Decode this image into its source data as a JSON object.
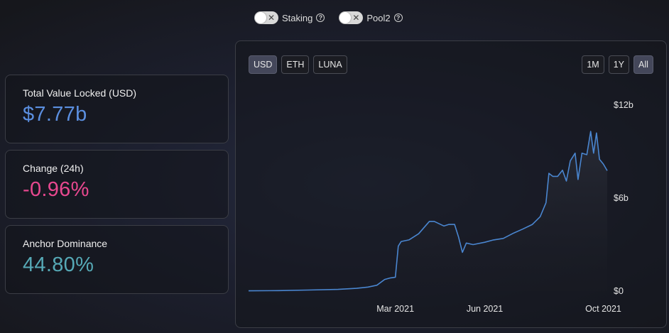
{
  "toggles": [
    {
      "label": "Staking",
      "on": false
    },
    {
      "label": "Pool2",
      "on": false
    }
  ],
  "stats": {
    "tvl": {
      "label": "Total Value Locked (USD)",
      "value": "$7.77b",
      "color": "#5b8fe0"
    },
    "change": {
      "label": "Change (24h)",
      "value": "-0.96%",
      "color": "#e8488f"
    },
    "dominance": {
      "label": "Anchor Dominance",
      "value": "44.80%",
      "color": "#56a9b6"
    }
  },
  "currency_buttons": [
    {
      "label": "USD",
      "active": true
    },
    {
      "label": "ETH",
      "active": false
    },
    {
      "label": "LUNA",
      "active": false
    }
  ],
  "range_buttons": [
    {
      "label": "1M",
      "active": false
    },
    {
      "label": "1Y",
      "active": false
    },
    {
      "label": "All",
      "active": true
    }
  ],
  "chart_data": {
    "type": "area",
    "line_color": "#4a86d0",
    "ylim": [
      0,
      12
    ],
    "y_ticks": [
      {
        "value": 12,
        "label": "$12b"
      },
      {
        "value": 6,
        "label": "$6b"
      },
      {
        "value": 0,
        "label": "$0"
      }
    ],
    "x_ticks": [
      {
        "value": "2021-03-01",
        "label": "Mar 2021"
      },
      {
        "value": "2021-06-01",
        "label": "Jun 2021"
      },
      {
        "value": "2021-10-01",
        "label": "Oct 2021"
      }
    ],
    "xlim": [
      "2020-10-01",
      "2021-10-05"
    ],
    "grid": false,
    "series": [
      {
        "values": [
          [
            "2020-10-01",
            0.02
          ],
          [
            "2020-11-01",
            0.03
          ],
          [
            "2020-12-01",
            0.07
          ],
          [
            "2021-01-01",
            0.11
          ],
          [
            "2021-01-20",
            0.18
          ],
          [
            "2021-02-01",
            0.26
          ],
          [
            "2021-02-10",
            0.38
          ],
          [
            "2021-02-18",
            0.75
          ],
          [
            "2021-02-24",
            0.85
          ],
          [
            "2021-03-01",
            0.9
          ],
          [
            "2021-03-04",
            2.9
          ],
          [
            "2021-03-07",
            3.2
          ],
          [
            "2021-03-15",
            3.3
          ],
          [
            "2021-03-25",
            3.7
          ],
          [
            "2021-04-05",
            4.5
          ],
          [
            "2021-04-10",
            4.5
          ],
          [
            "2021-04-20",
            4.2
          ],
          [
            "2021-04-25",
            4.3
          ],
          [
            "2021-05-01",
            4.3
          ],
          [
            "2021-05-05",
            3.5
          ],
          [
            "2021-05-09",
            2.5
          ],
          [
            "2021-05-13",
            3.1
          ],
          [
            "2021-05-20",
            3.0
          ],
          [
            "2021-06-01",
            3.15
          ],
          [
            "2021-06-10",
            3.3
          ],
          [
            "2021-06-20",
            3.4
          ],
          [
            "2021-07-01",
            3.75
          ],
          [
            "2021-07-10",
            4.0
          ],
          [
            "2021-07-20",
            4.3
          ],
          [
            "2021-07-28",
            4.8
          ],
          [
            "2021-08-03",
            5.7
          ],
          [
            "2021-08-06",
            7.6
          ],
          [
            "2021-08-10",
            7.4
          ],
          [
            "2021-08-15",
            7.4
          ],
          [
            "2021-08-20",
            7.8
          ],
          [
            "2021-08-24",
            7.1
          ],
          [
            "2021-08-28",
            8.4
          ],
          [
            "2021-09-02",
            8.9
          ],
          [
            "2021-09-05",
            7.2
          ],
          [
            "2021-09-09",
            8.9
          ],
          [
            "2021-09-14",
            8.8
          ],
          [
            "2021-09-18",
            10.3
          ],
          [
            "2021-09-21",
            8.9
          ],
          [
            "2021-09-24",
            10.2
          ],
          [
            "2021-09-27",
            8.5
          ],
          [
            "2021-10-01",
            8.2
          ],
          [
            "2021-10-05",
            7.77
          ]
        ]
      }
    ]
  }
}
